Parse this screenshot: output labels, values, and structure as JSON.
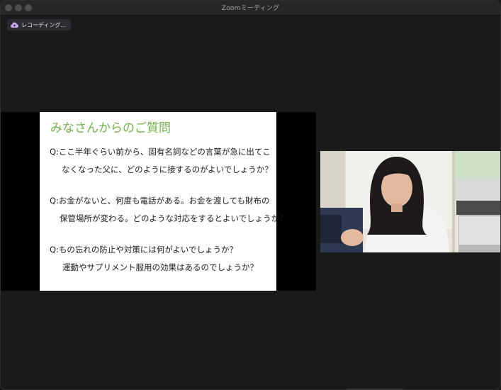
{
  "window": {
    "title": "Zoomミーティング"
  },
  "recording": {
    "label": "レコーディング...",
    "icon": "cloud-recording-icon",
    "icon_color": "#c9a7e8"
  },
  "slide": {
    "title": "みなさんからのご質問",
    "title_color": "#74b150",
    "questions": [
      {
        "line1": "Q:ここ半年ぐらい前から、固有名詞などの言葉が急に出てこ",
        "line2": "なくなった父に、どのように接するのがよいでしょうか？"
      },
      {
        "line1": "Q:お金がないと、何度も電話がある。お金を渡しても財布の",
        "line2": "保管場所が変わる。どのような対応をするとよいでしょうか？"
      },
      {
        "line1": "Q:もの忘れの防止や対策には何がよいでしょうか？",
        "line2": "運動やサプリメント服用の効果はあるのでしょうか？"
      }
    ]
  },
  "participant_video": {
    "icon": "participant-video"
  }
}
